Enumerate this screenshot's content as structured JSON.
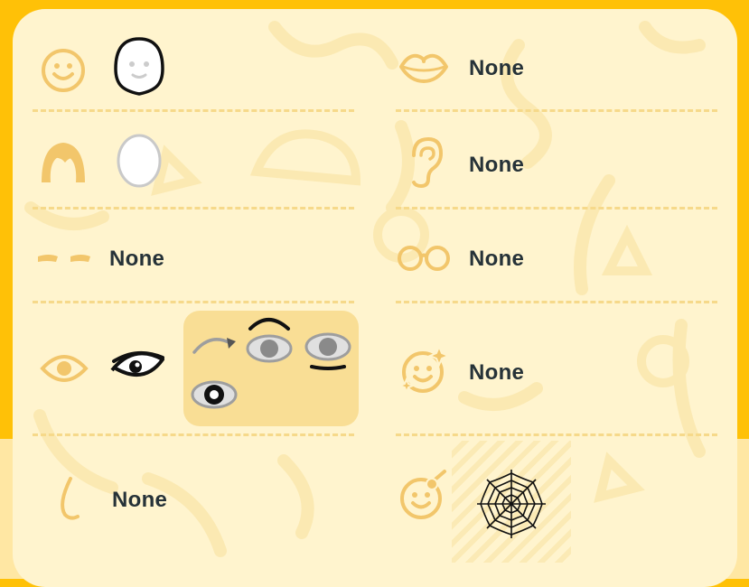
{
  "colors": {
    "frame": "#FFC107",
    "panel": "#FFF4CE",
    "icon": "#F2C66B",
    "label": "#263238",
    "variant_panel": "#F9DE95"
  },
  "left_rows": [
    {
      "category": "face-shape",
      "icon": "smiley-face-icon",
      "value": null
    },
    {
      "category": "hair",
      "icon": "hair-icon",
      "value": null
    },
    {
      "category": "eyebrows",
      "icon": "eyebrows-icon",
      "value": "None"
    },
    {
      "category": "eyes",
      "icon": "eye-icon",
      "value": null
    },
    {
      "category": "nose",
      "icon": "nose-icon",
      "value": "None"
    }
  ],
  "right_rows": [
    {
      "category": "mouth",
      "icon": "lips-icon",
      "value": "None"
    },
    {
      "category": "ears",
      "icon": "ear-icon",
      "value": "None"
    },
    {
      "category": "glasses",
      "icon": "glasses-icon",
      "value": "None"
    },
    {
      "category": "face-decoration",
      "icon": "sparkle-face-icon",
      "value": "None"
    },
    {
      "category": "face-accessory",
      "icon": "face-accessory-icon",
      "value": null
    }
  ]
}
